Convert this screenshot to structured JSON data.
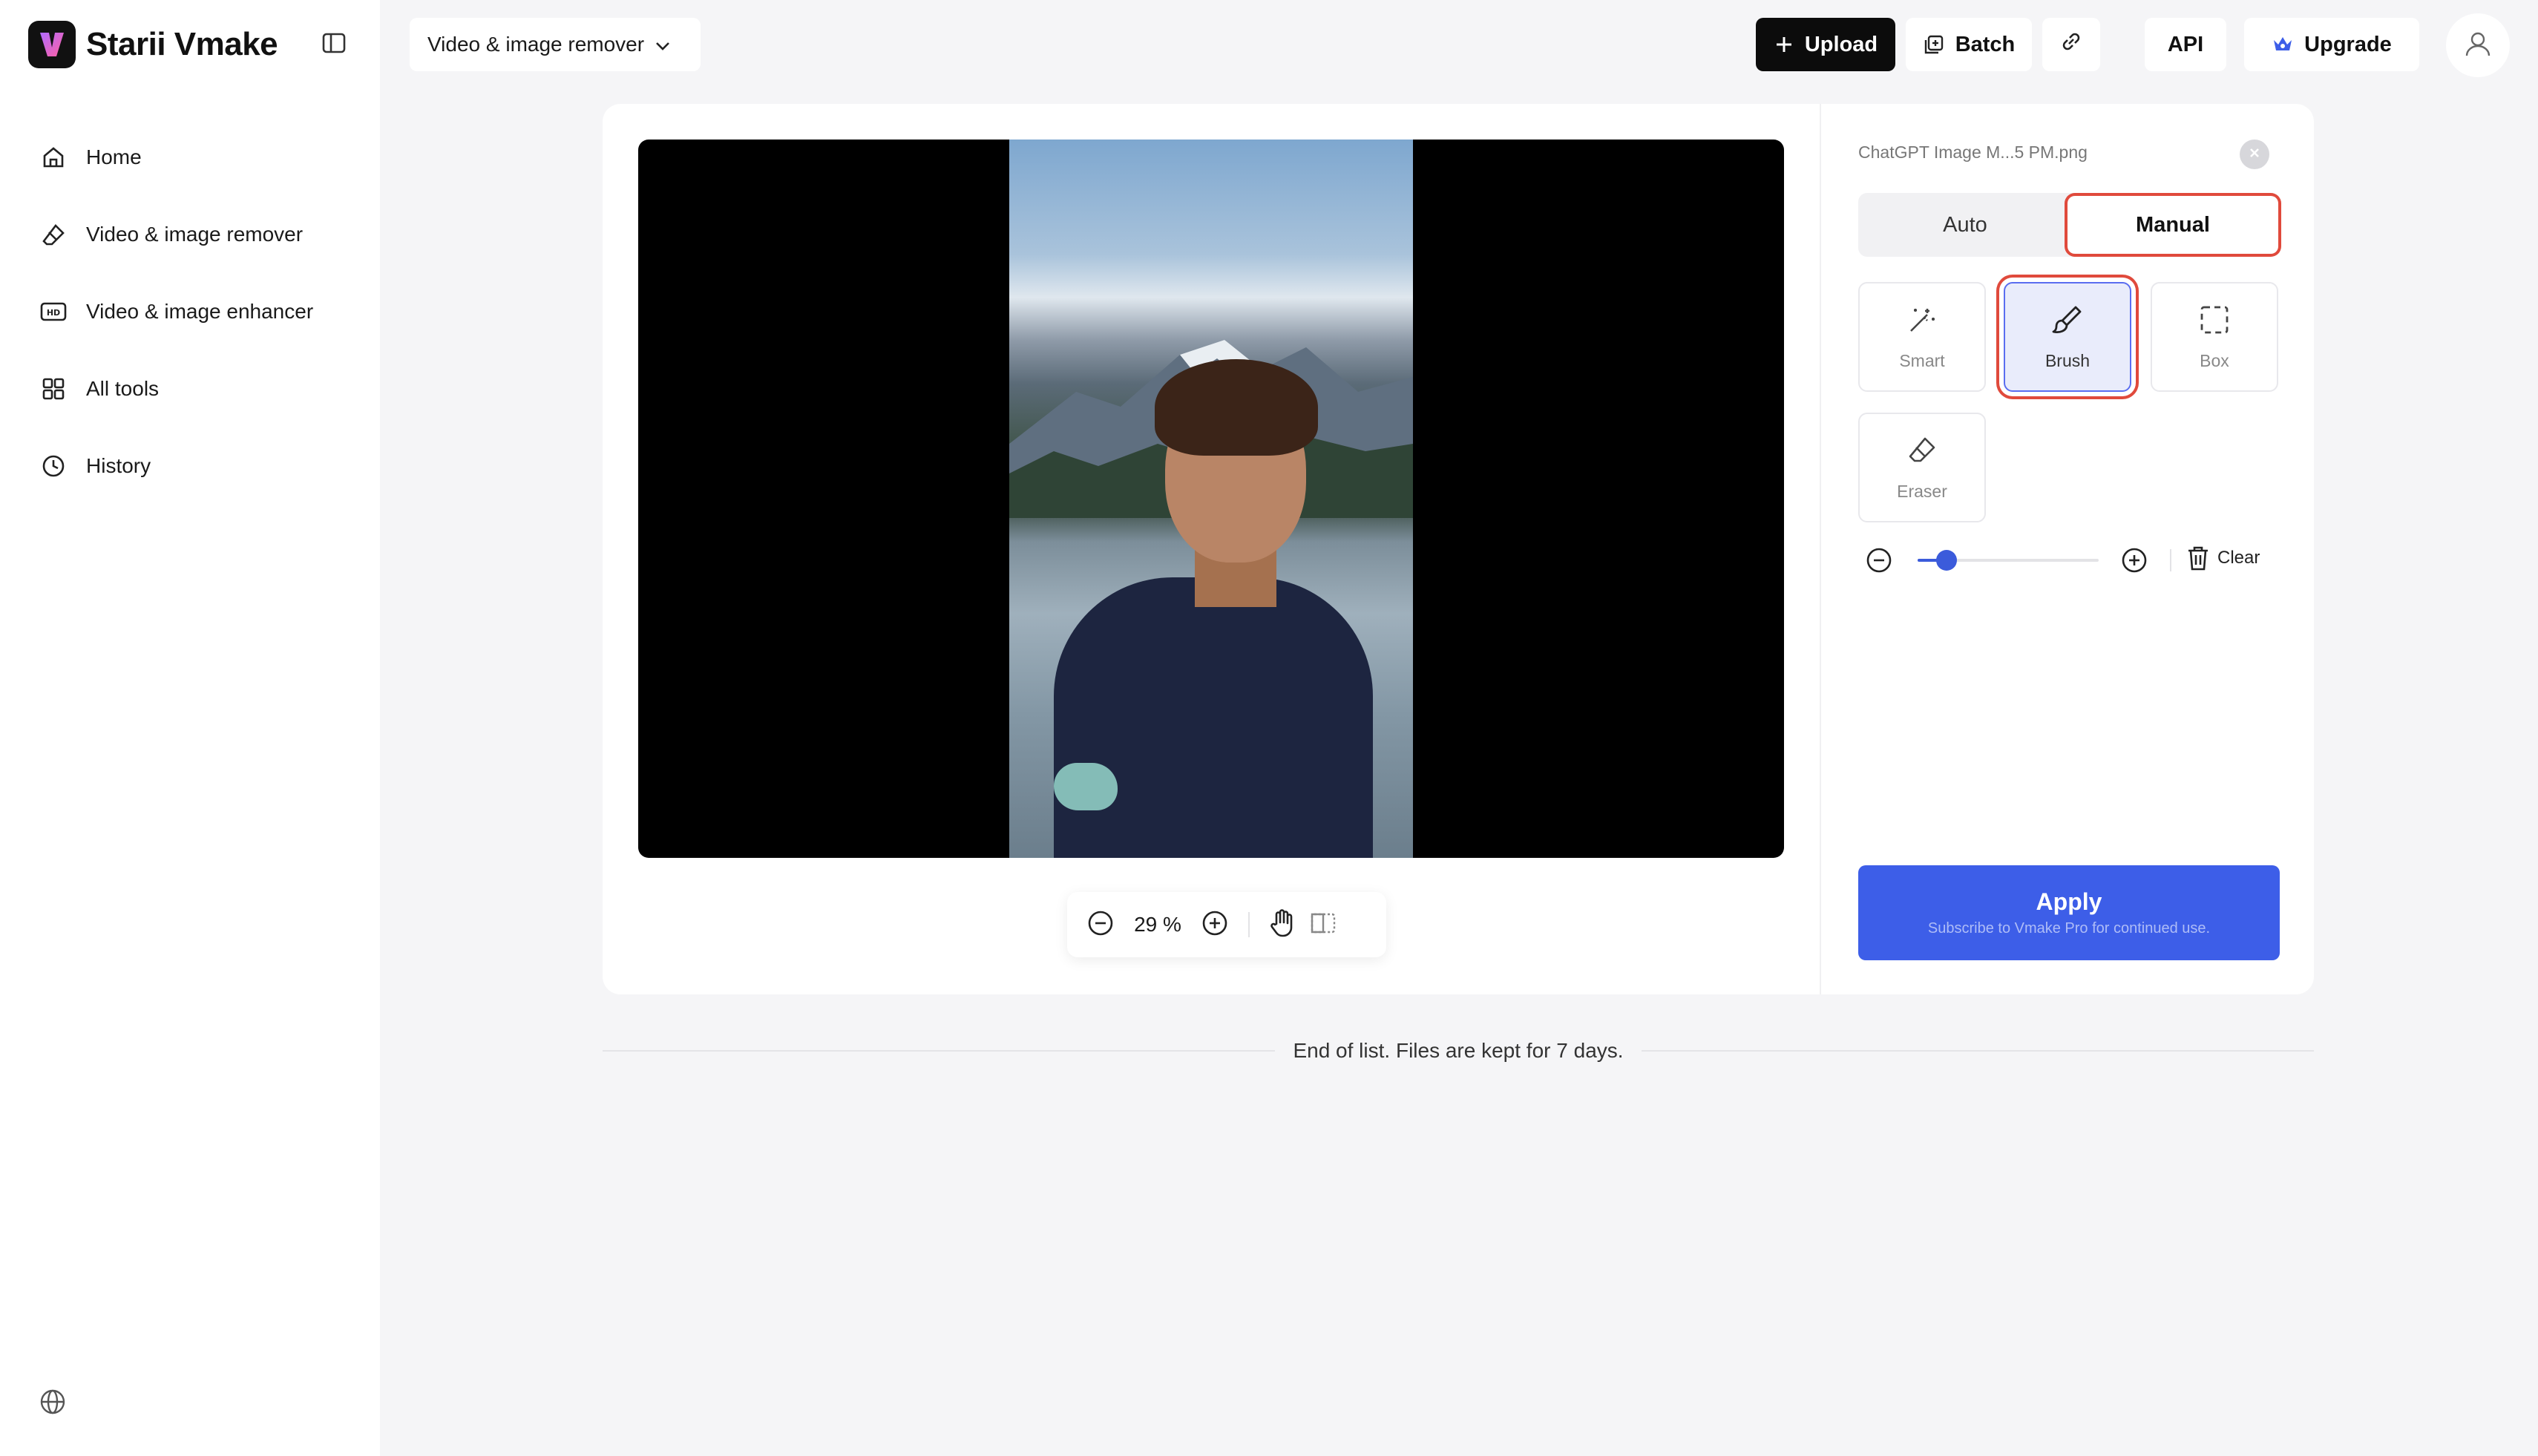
{
  "app": {
    "name": "Starii Vmake"
  },
  "sidebar": {
    "items": [
      {
        "label": "Home",
        "icon": "home-icon"
      },
      {
        "label": "Video & image remover",
        "icon": "eraser-icon"
      },
      {
        "label": "Video & image enhancer",
        "icon": "hd-icon"
      },
      {
        "label": "All tools",
        "icon": "grid-icon"
      },
      {
        "label": "History",
        "icon": "clock-icon"
      }
    ]
  },
  "topbar": {
    "tool_select": "Video & image remover",
    "upload": "Upload",
    "batch": "Batch",
    "api": "API",
    "upgrade": "Upgrade"
  },
  "editor": {
    "zoom": "29 %",
    "file_name": "ChatGPT Image M...5 PM.png",
    "modes": {
      "auto": "Auto",
      "manual": "Manual",
      "selected": "Manual"
    },
    "tools": {
      "smart": "Smart",
      "brush": "Brush",
      "box": "Box",
      "eraser": "Eraser",
      "selected": "Brush"
    },
    "brush_size": {
      "fraction": 0.16
    },
    "clear": "Clear",
    "apply": {
      "label": "Apply",
      "subtitle": "Subscribe to Vmake Pro for continued use."
    }
  },
  "footer": {
    "text": "End of list. Files are kept for 7 days."
  },
  "colors": {
    "accent": "#3d5ee8",
    "highlight": "#e04a3c",
    "dark": "#0c0c0c"
  }
}
